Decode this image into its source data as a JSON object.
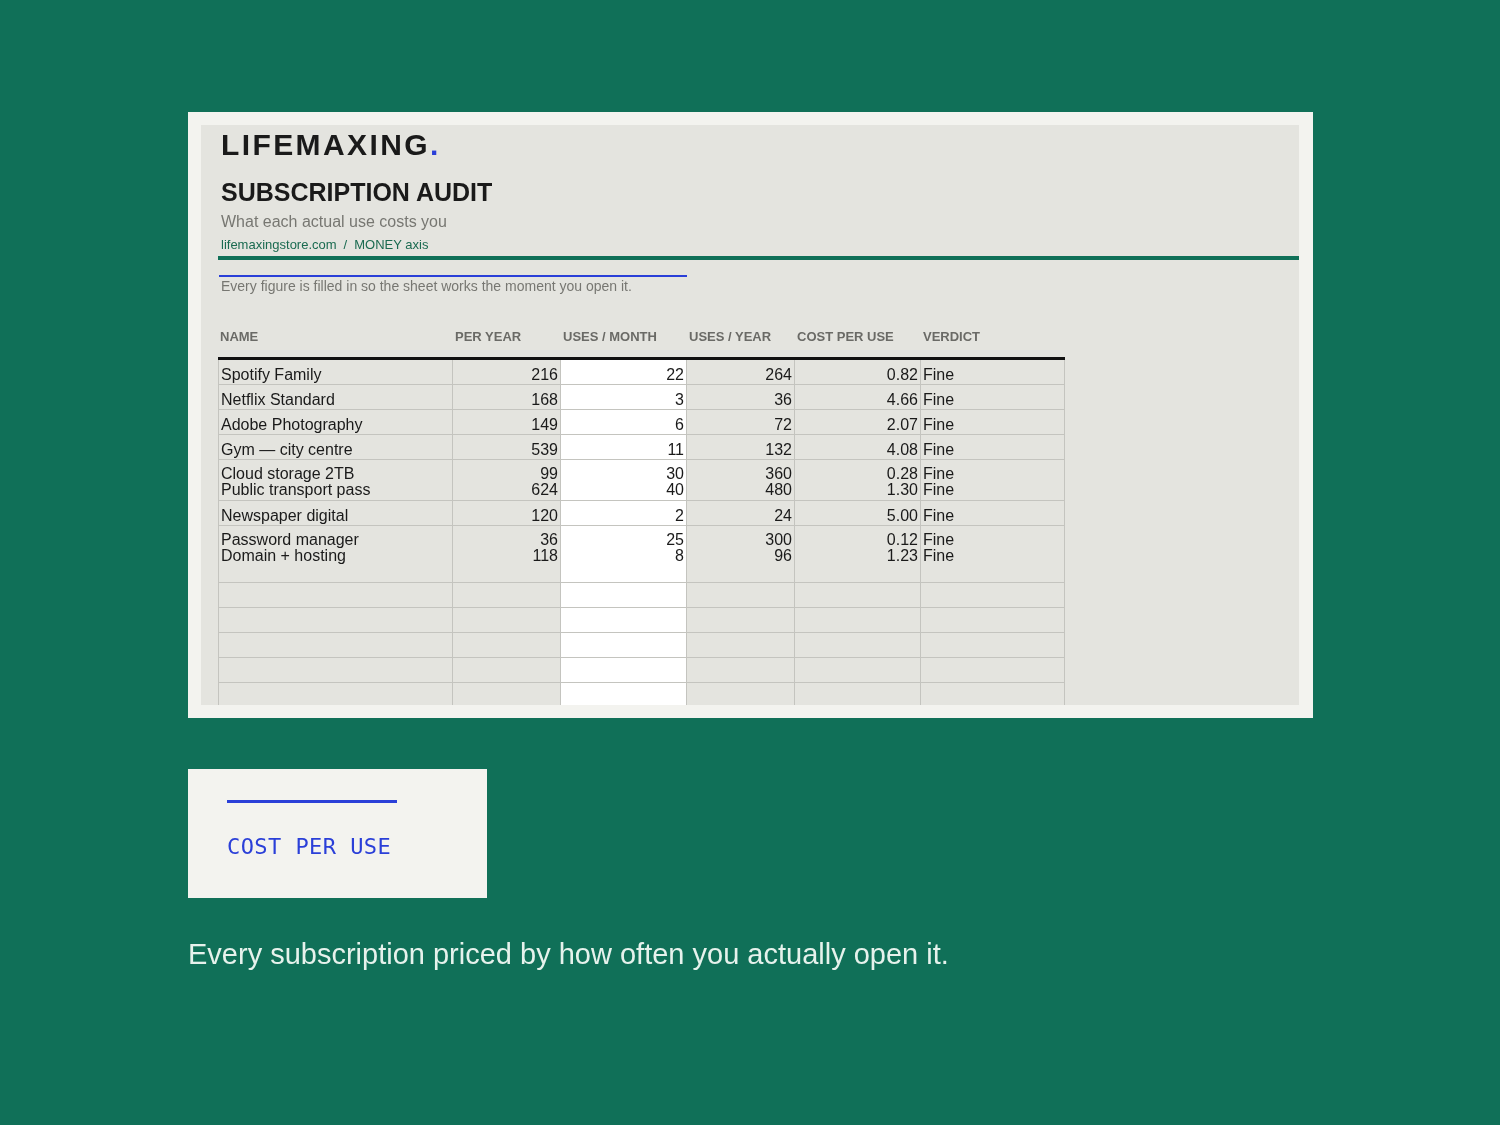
{
  "sheet": {
    "brand": "LIFEMAXING",
    "brand_dot": ".",
    "title": "SUBSCRIPTION AUDIT",
    "subtitle": "What each actual use costs you",
    "breadcrumb": [
      "lifemaxingstore.com",
      "/",
      "MONEY axis"
    ],
    "note": "Every figure is filled in so the sheet works the moment you open it."
  },
  "table": {
    "columns": [
      "NAME",
      "PER YEAR",
      "USES / MONTH",
      "USES / YEAR",
      "COST PER USE",
      "VERDICT"
    ],
    "rows": [
      {
        "entries": [
          [
            "Spotify Family",
            "216",
            "22",
            "264",
            "0.82",
            "Fine"
          ]
        ]
      },
      {
        "entries": [
          [
            "Netflix Standard",
            "168",
            "3",
            "36",
            "4.66",
            "Fine"
          ]
        ]
      },
      {
        "entries": [
          [
            "Adobe Photography",
            "149",
            "6",
            "72",
            "2.07",
            "Fine"
          ]
        ]
      },
      {
        "entries": [
          [
            "Gym — city centre",
            "539",
            "11",
            "132",
            "4.08",
            "Fine"
          ]
        ]
      },
      {
        "entries": [
          [
            "Cloud storage 2TB",
            "99",
            "30",
            "360",
            "0.28",
            "Fine"
          ],
          [
            "Public transport pass",
            "624",
            "40",
            "480",
            "1.30",
            "Fine"
          ]
        ]
      },
      {
        "entries": [
          [
            "Newspaper digital",
            "120",
            "2",
            "24",
            "5.00",
            "Fine"
          ]
        ]
      },
      {
        "entries": [
          [
            "Password manager",
            "36",
            "25",
            "300",
            "0.12",
            "Fine"
          ],
          [
            "Domain + hosting",
            "118",
            "8",
            "96",
            "1.23",
            "Fine"
          ]
        ]
      }
    ]
  },
  "label_card": {
    "text": "COST PER USE"
  },
  "caption": "Every subscription priced by how often you actually open it."
}
